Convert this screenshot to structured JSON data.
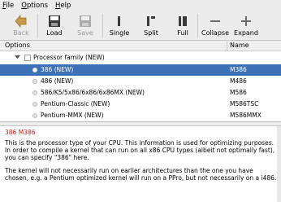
{
  "menubar": {
    "items": [
      "File",
      "Options",
      "Help"
    ]
  },
  "toolbar": {
    "back": "Back",
    "load": "Load",
    "save": "Save",
    "single": "Single",
    "split": "Split",
    "full": "Full",
    "collapse": "Collapse",
    "expand": "Expand"
  },
  "tree": {
    "columns": {
      "options": "Options",
      "name": "Name"
    },
    "parent": {
      "label": "Processor family (NEW)"
    },
    "rows": [
      {
        "label": "386 (NEW)",
        "name": "M386",
        "selected": true
      },
      {
        "label": "486 (NEW)",
        "name": "M486",
        "selected": false
      },
      {
        "label": "586/K5/5x86/6x86/6x86MX (NEW)",
        "name": "M586",
        "selected": false
      },
      {
        "label": "Pentium-Classic (NEW)",
        "name": "M586TSC",
        "selected": false
      },
      {
        "label": "Pentium-MMX (NEW)",
        "name": "M586MMX",
        "selected": false
      }
    ]
  },
  "help": {
    "title": "386 M386",
    "p1": "This is the processor type of your CPU. This information is used for optimizing purposes. In order to compile a kernel that can run on all x86 CPU types (albeit not optimally fast), you can specify \"386\" here.",
    "p2": "The kernel will not necessarily run on earlier architectures than the one you have chosen, e.g. a Pentium optimized kernel will run on a PPro, but not necessarily on a i486."
  },
  "colors": {
    "selection": "#3d72b8",
    "help_title": "#d01818"
  }
}
